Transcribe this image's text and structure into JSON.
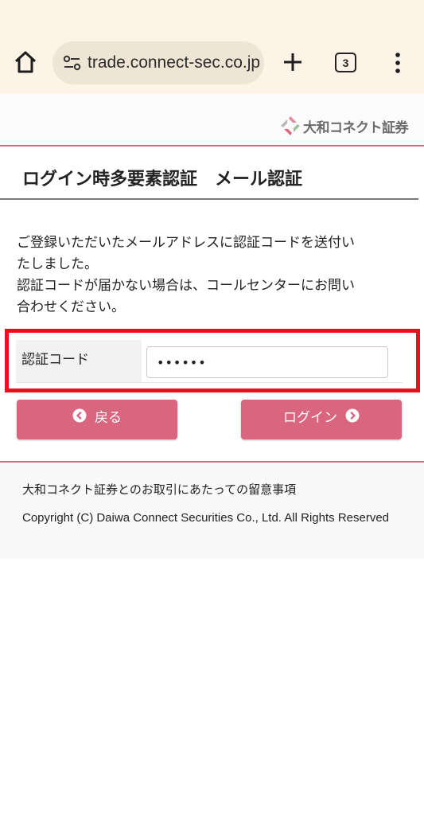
{
  "browser": {
    "url": "trade.connect-sec.co.jp",
    "tab_count": "3"
  },
  "header": {
    "logo_text": "大和コネクト証券"
  },
  "page": {
    "title": "ログイン時多要素認証　メール認証",
    "message_lines": [
      "ご登録いただいたメールアドレスに認証コードを送付い",
      "たしました。",
      "認証コードが届かない場合は、コールセンターにお問い",
      "合わせください。"
    ]
  },
  "form": {
    "code_label": "認証コード",
    "code_value": "••••••"
  },
  "buttons": {
    "back_label": "戻る",
    "login_label": "ログイン"
  },
  "footer": {
    "notice_link": "大和コネクト証券とのお取引にあたっての留意事項",
    "copyright": "Copyright (C) Daiwa Connect Securities Co., Ltd. All Rights Reserved"
  },
  "colors": {
    "brand": "#d9657f",
    "highlight": "#e8101c",
    "chrome_bg": "#fdf3e7"
  }
}
